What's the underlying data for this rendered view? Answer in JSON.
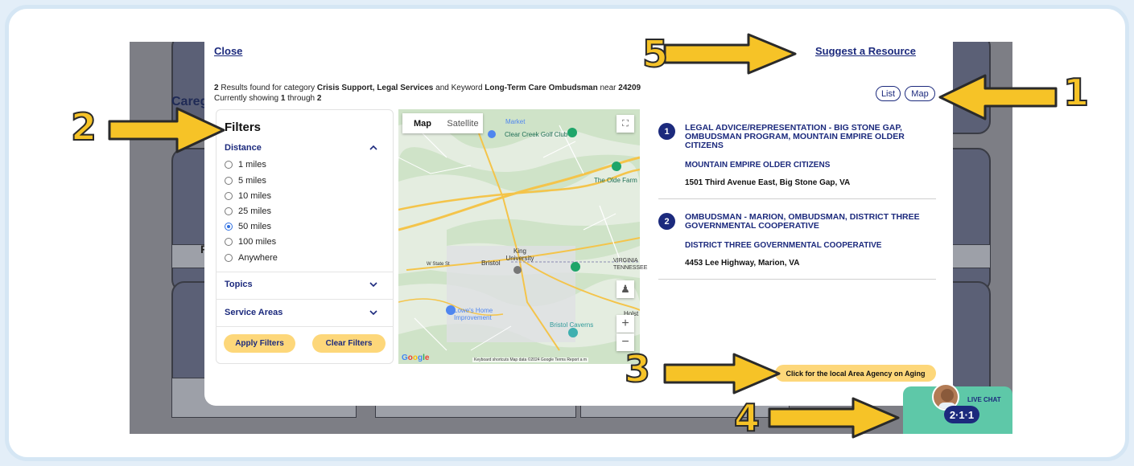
{
  "background": {
    "partial_label": "Careg",
    "left_letter": "F"
  },
  "modal": {
    "close_label": "Close",
    "suggest_label": "Suggest a Resource",
    "results": {
      "count": "2",
      "text1": " Results found for category ",
      "categories": "Crisis Support, Legal Services",
      "text2": " and Keyword ",
      "keyword": "Long-Term Care Ombudsman",
      "text3": " near ",
      "zip": "24209",
      "showing_prefix": "Currently showing ",
      "showing_from": "1",
      "showing_mid": " through ",
      "showing_to": "2"
    },
    "view_toggle": {
      "list": "List",
      "map": "Map"
    }
  },
  "filters": {
    "title": "Filters",
    "distance_label": "Distance",
    "distance_options": [
      "1 miles",
      "5 miles",
      "10 miles",
      "25 miles",
      "50 miles",
      "100 miles",
      "Anywhere"
    ],
    "distance_selected": "50 miles",
    "topics_label": "Topics",
    "service_areas_label": "Service Areas",
    "apply_label": "Apply Filters",
    "clear_label": "Clear Filters"
  },
  "map": {
    "tab_map": "Map",
    "tab_satellite": "Satellite",
    "places": {
      "clear_creek": "Clear Creek Golf Club",
      "market": "Market",
      "olde_farm": "The Olde Farm",
      "bristol": "Bristol",
      "king_university": "King University",
      "virginia": "VIRGINIA TENNESSEE",
      "lowes": "Lowe's Home Improvement",
      "bristol_caverns": "Bristol Caverns",
      "holston": "Holst",
      "w_state_st": "W State St"
    },
    "footer": "Keyboard shortcuts   Map data ©2024 Google   Terms   Report a m",
    "google": "Google",
    "zoom_in": "+",
    "zoom_out": "−"
  },
  "results": [
    {
      "number": "1",
      "title": "LEGAL ADVICE/REPRESENTATION - BIG STONE GAP, OMBUDSMAN PROGRAM, MOUNTAIN EMPIRE OLDER CITIZENS",
      "org": "MOUNTAIN EMPIRE OLDER CITIZENS",
      "address": "1501 Third Avenue East, Big Stone Gap, VA"
    },
    {
      "number": "2",
      "title": "OMBUDSMAN - MARION, OMBUDSMAN, DISTRICT THREE GOVERNMENTAL COOPERATIVE",
      "org": "DISTRICT THREE GOVERNMENTAL COOPERATIVE",
      "address": "4453 Lee Highway, Marion, VA"
    }
  ],
  "aging_button": "Click for the local Area Agency on Aging",
  "live_chat": {
    "label": "LIVE CHAT",
    "badge": "2·1·1"
  },
  "annotations": [
    "1",
    "2",
    "3",
    "4",
    "5"
  ],
  "colors": {
    "accent": "#1c2a7d",
    "yellow": "#fdd77a",
    "arrow": "#f6c327",
    "chat": "#5ec8a8"
  }
}
